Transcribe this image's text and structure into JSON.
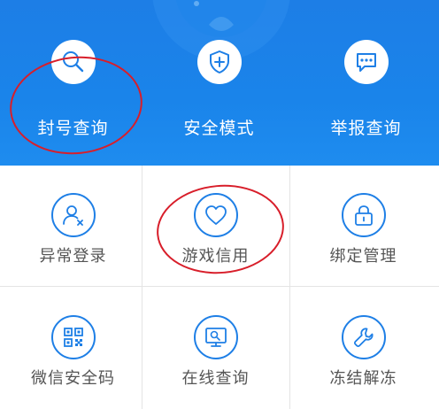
{
  "colors": {
    "hero_blue": "#1a84ea",
    "icon_blue": "#1e7fe6",
    "annotation_red": "#d81e2a",
    "grid_label": "#555555",
    "divider": "#e4e4e4"
  },
  "top_actions": [
    {
      "label": "封号查询",
      "icon": "search-icon"
    },
    {
      "label": "安全模式",
      "icon": "shield-plus-icon"
    },
    {
      "label": "举报查询",
      "icon": "message-dots-icon"
    }
  ],
  "grid_items": [
    {
      "label": "异常登录",
      "icon": "user-x-icon"
    },
    {
      "label": "游戏信用",
      "icon": "heart-icon"
    },
    {
      "label": "绑定管理",
      "icon": "lock-icon"
    },
    {
      "label": "微信安全码",
      "icon": "qr-code-icon"
    },
    {
      "label": "在线查询",
      "icon": "monitor-search-icon"
    },
    {
      "label": "冻结解冻",
      "icon": "wrench-icon"
    }
  ],
  "annotations": [
    "red-circle-around-封号查询",
    "red-circle-around-游戏信用"
  ]
}
